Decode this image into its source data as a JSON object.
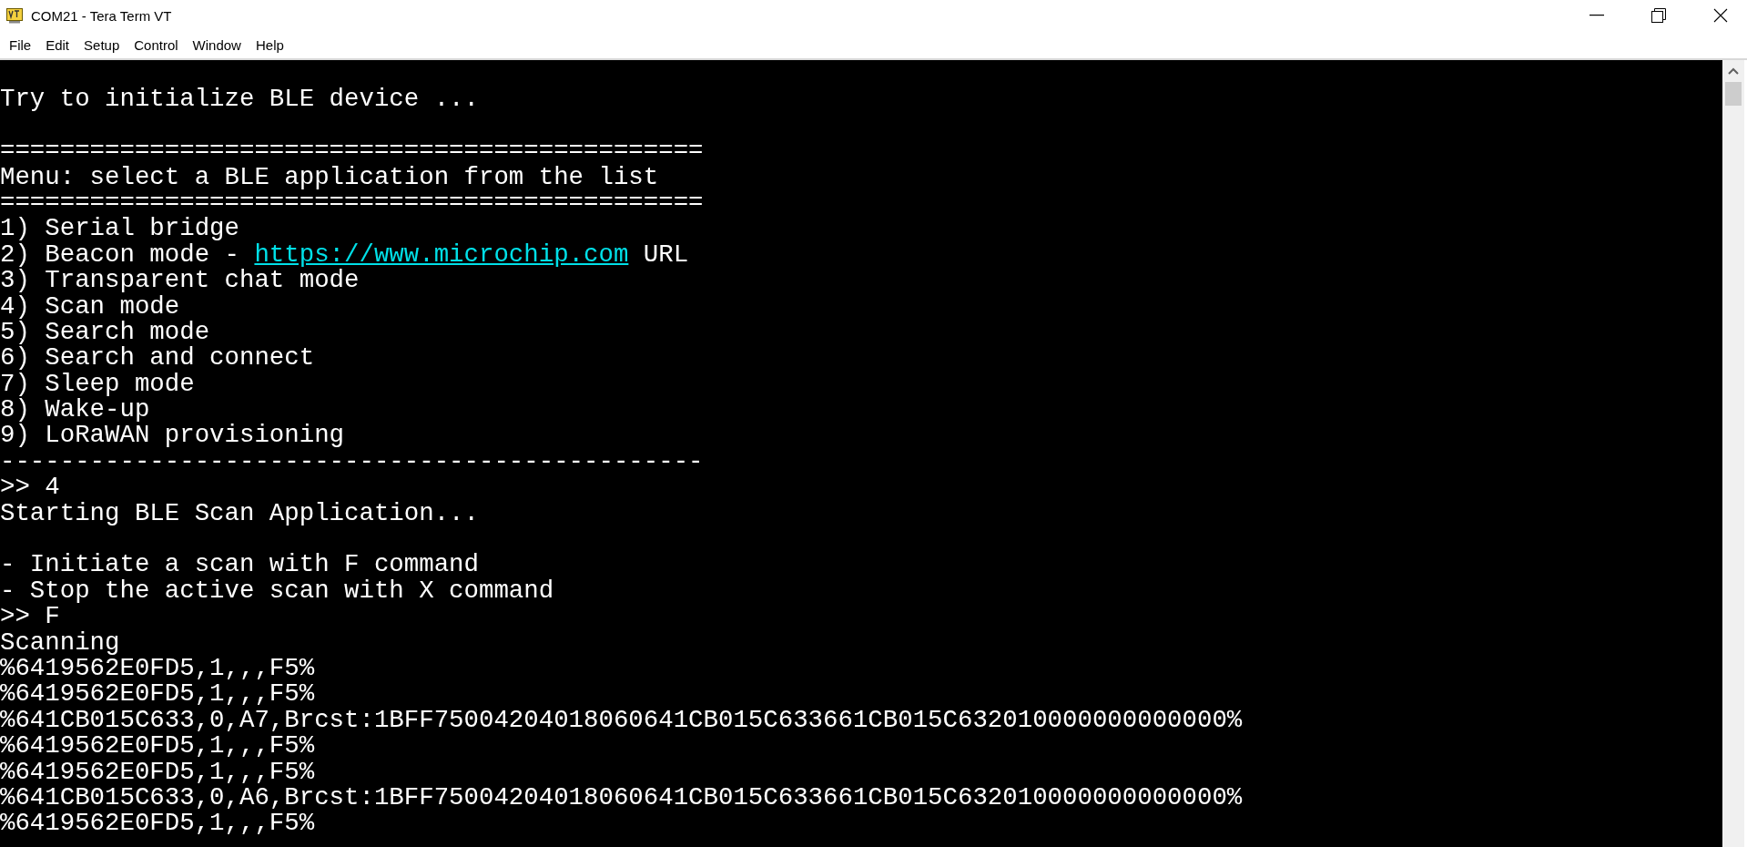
{
  "window": {
    "title": "COM21 - Tera Term VT"
  },
  "menu": [
    "File",
    "Edit",
    "Setup",
    "Control",
    "Window",
    "Help"
  ],
  "terminal": {
    "lines": [
      {
        "kind": "blank"
      },
      {
        "kind": "text",
        "segments": [
          {
            "kind": "plain",
            "text": "Try to initialize BLE device ..."
          }
        ]
      },
      {
        "kind": "blank"
      },
      {
        "kind": "text",
        "segments": [
          {
            "kind": "plain",
            "text": "==============================================="
          }
        ]
      },
      {
        "kind": "text",
        "segments": [
          {
            "kind": "plain",
            "text": "Menu: select a BLE application from the list"
          }
        ]
      },
      {
        "kind": "text",
        "segments": [
          {
            "kind": "plain",
            "text": "==============================================="
          }
        ]
      },
      {
        "kind": "text",
        "segments": [
          {
            "kind": "plain",
            "text": "1) Serial bridge"
          }
        ]
      },
      {
        "kind": "text",
        "segments": [
          {
            "kind": "plain",
            "text": "2) Beacon mode - "
          },
          {
            "kind": "link",
            "text": "https://www.microchip.com"
          },
          {
            "kind": "plain",
            "text": " URL"
          }
        ]
      },
      {
        "kind": "text",
        "segments": [
          {
            "kind": "plain",
            "text": "3) Transparent chat mode"
          }
        ]
      },
      {
        "kind": "text",
        "segments": [
          {
            "kind": "plain",
            "text": "4) Scan mode"
          }
        ]
      },
      {
        "kind": "text",
        "segments": [
          {
            "kind": "plain",
            "text": "5) Search mode"
          }
        ]
      },
      {
        "kind": "text",
        "segments": [
          {
            "kind": "plain",
            "text": "6) Search and connect"
          }
        ]
      },
      {
        "kind": "text",
        "segments": [
          {
            "kind": "plain",
            "text": "7) Sleep mode"
          }
        ]
      },
      {
        "kind": "text",
        "segments": [
          {
            "kind": "plain",
            "text": "8) Wake-up"
          }
        ]
      },
      {
        "kind": "text",
        "segments": [
          {
            "kind": "plain",
            "text": "9) LoRaWAN provisioning"
          }
        ]
      },
      {
        "kind": "text",
        "segments": [
          {
            "kind": "plain",
            "text": "-----------------------------------------------"
          }
        ]
      },
      {
        "kind": "text",
        "segments": [
          {
            "kind": "plain",
            "text": ">> 4"
          }
        ]
      },
      {
        "kind": "text",
        "segments": [
          {
            "kind": "plain",
            "text": "Starting BLE Scan Application..."
          }
        ]
      },
      {
        "kind": "blank"
      },
      {
        "kind": "text",
        "segments": [
          {
            "kind": "plain",
            "text": "- Initiate a scan with F command"
          }
        ]
      },
      {
        "kind": "text",
        "segments": [
          {
            "kind": "plain",
            "text": "- Stop the active scan with X command"
          }
        ]
      },
      {
        "kind": "text",
        "segments": [
          {
            "kind": "plain",
            "text": ">> F"
          }
        ]
      },
      {
        "kind": "text",
        "segments": [
          {
            "kind": "plain",
            "text": "Scanning"
          }
        ]
      },
      {
        "kind": "text",
        "segments": [
          {
            "kind": "plain",
            "text": "%6419562E0FD5,1,,,F5%"
          }
        ]
      },
      {
        "kind": "text",
        "segments": [
          {
            "kind": "plain",
            "text": "%6419562E0FD5,1,,,F5%"
          }
        ]
      },
      {
        "kind": "text",
        "segments": [
          {
            "kind": "plain",
            "text": "%641CB015C633,0,A7,Brcst:1BFF75004204018060641CB015C633661CB015C632010000000000000%"
          }
        ]
      },
      {
        "kind": "text",
        "segments": [
          {
            "kind": "plain",
            "text": "%6419562E0FD5,1,,,F5%"
          }
        ]
      },
      {
        "kind": "text",
        "segments": [
          {
            "kind": "plain",
            "text": "%6419562E0FD5,1,,,F5%"
          }
        ]
      },
      {
        "kind": "text",
        "segments": [
          {
            "kind": "plain",
            "text": "%641CB015C633,0,A6,Brcst:1BFF75004204018060641CB015C633661CB015C632010000000000000%"
          }
        ]
      },
      {
        "kind": "text",
        "segments": [
          {
            "kind": "plain",
            "text": "%6419562E0FD5,1,,,F5%"
          }
        ]
      }
    ]
  }
}
